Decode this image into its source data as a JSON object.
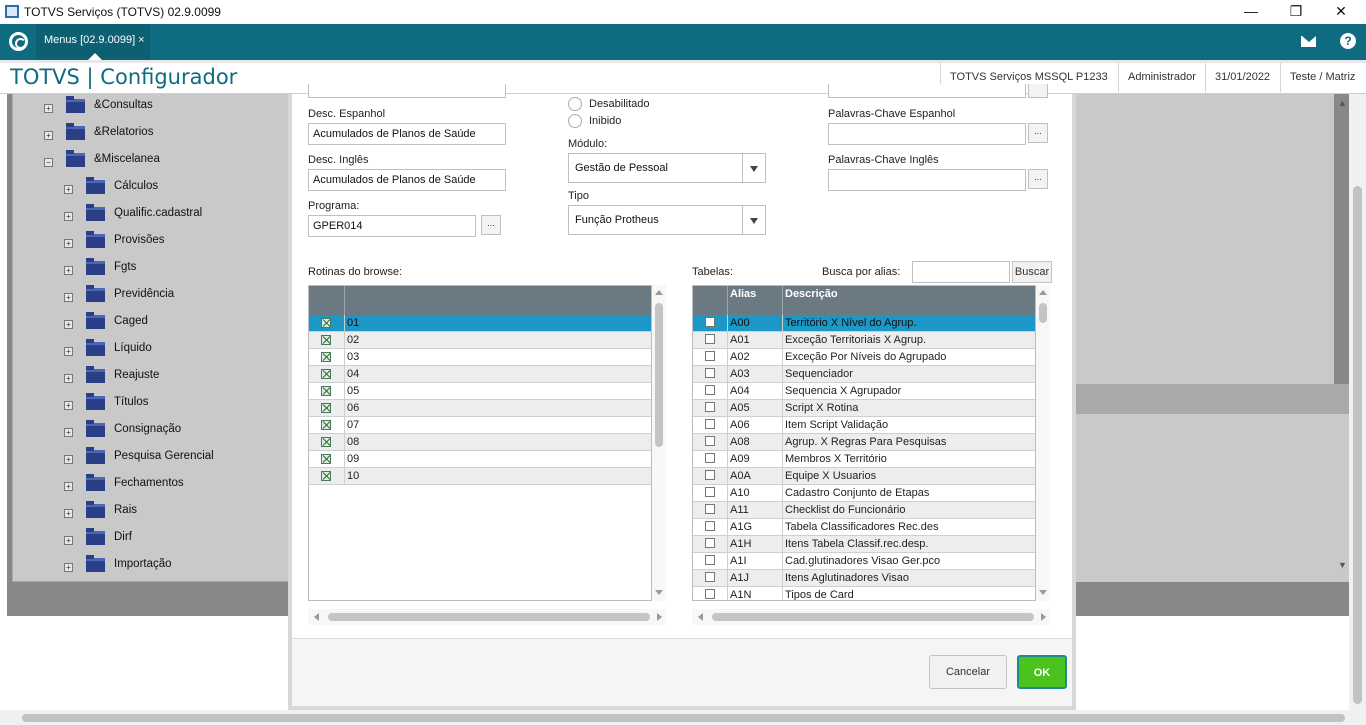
{
  "window": {
    "title": "TOTVS Serviços (TOTVS) 02.9.0099",
    "minimize": "—",
    "restore": "❐",
    "close": "✕"
  },
  "tabbar": {
    "tab_label": "Menus [02.9.0099]",
    "tab_close": "×"
  },
  "header": {
    "app_title": "TOTVS | Configurador",
    "environment": "TOTVS Serviços MSSQL P1233",
    "user": "Administrador",
    "date": "31/01/2022",
    "company": "Teste / Matriz"
  },
  "tree": {
    "top_items": [
      {
        "label": "&Consultas",
        "exp": "+"
      },
      {
        "label": "&Relatorios",
        "exp": "+"
      },
      {
        "label": "&Miscelanea",
        "exp": "−"
      }
    ],
    "children": [
      "Cálculos",
      "Qualific.cadastral",
      "Provisões",
      "Fgts",
      "Previdência",
      "Caged",
      "Líquido",
      "Reajuste",
      "Títulos",
      "Consignação",
      "Pesquisa Gerencial",
      "Fechamentos",
      "Rais",
      "Dirf",
      "Importação"
    ]
  },
  "form": {
    "desc_espanhol_label": "Desc. Espanhol",
    "desc_espanhol_value": "Acumulados de Planos de Saúde",
    "desc_ingles_label": "Desc. Inglês",
    "desc_ingles_value": "Acumulados de Planos de Saúde",
    "programa_label": "Programa:",
    "programa_value": "GPER014",
    "radio_desabilitado": "Desabilitado",
    "radio_inibido": "Inibido",
    "modulo_label": "Módulo:",
    "modulo_value": "Gestão de Pessoal",
    "tipo_label": "Tipo",
    "tipo_value": "Função Protheus",
    "kw_espanhol_label": "Palavras-Chave Espanhol",
    "kw_ingles_label": "Palavras-Chave Inglês",
    "dots": "..."
  },
  "rotinas": {
    "label": "Rotinas do browse:",
    "rows": [
      "01",
      "02",
      "03",
      "04",
      "05",
      "06",
      "07",
      "08",
      "09",
      "10"
    ]
  },
  "tabelas": {
    "label": "Tabelas:",
    "search_label": "Busca por alias:",
    "search_value": "",
    "search_button": "Buscar",
    "col_alias": "Alias",
    "col_desc": "Descrição",
    "rows": [
      {
        "alias": "A00",
        "desc": "Território X Nível do Agrup."
      },
      {
        "alias": "A01",
        "desc": "Exceção Territoriais X Agrup."
      },
      {
        "alias": "A02",
        "desc": "Exceção Por Níveis do Agrupado"
      },
      {
        "alias": "A03",
        "desc": "Sequenciador"
      },
      {
        "alias": "A04",
        "desc": "Sequencia X Agrupador"
      },
      {
        "alias": "A05",
        "desc": "Script X Rotina"
      },
      {
        "alias": "A06",
        "desc": "Item Script Validação"
      },
      {
        "alias": "A08",
        "desc": "Agrup. X Regras Para Pesquisas"
      },
      {
        "alias": "A09",
        "desc": "Membros X Território"
      },
      {
        "alias": "A0A",
        "desc": "Equipe X Usuarios"
      },
      {
        "alias": "A10",
        "desc": "Cadastro Conjunto de Etapas"
      },
      {
        "alias": "A11",
        "desc": "Checklist do Funcionário"
      },
      {
        "alias": "A1G",
        "desc": "Tabela Classificadores Rec.des"
      },
      {
        "alias": "A1H",
        "desc": "Itens Tabela Classif.rec.desp."
      },
      {
        "alias": "A1I",
        "desc": "Cad.glutinadores Visao Ger.pco"
      },
      {
        "alias": "A1J",
        "desc": "Itens Aglutinadores Visao"
      },
      {
        "alias": "A1N",
        "desc": "Tipos de Card"
      }
    ]
  },
  "buttons": {
    "cancel": "Cancelar",
    "ok": "OK"
  },
  "colors": {
    "brand": "#0f6b80",
    "selection": "#1b98c6",
    "ok": "#4cc21f"
  }
}
